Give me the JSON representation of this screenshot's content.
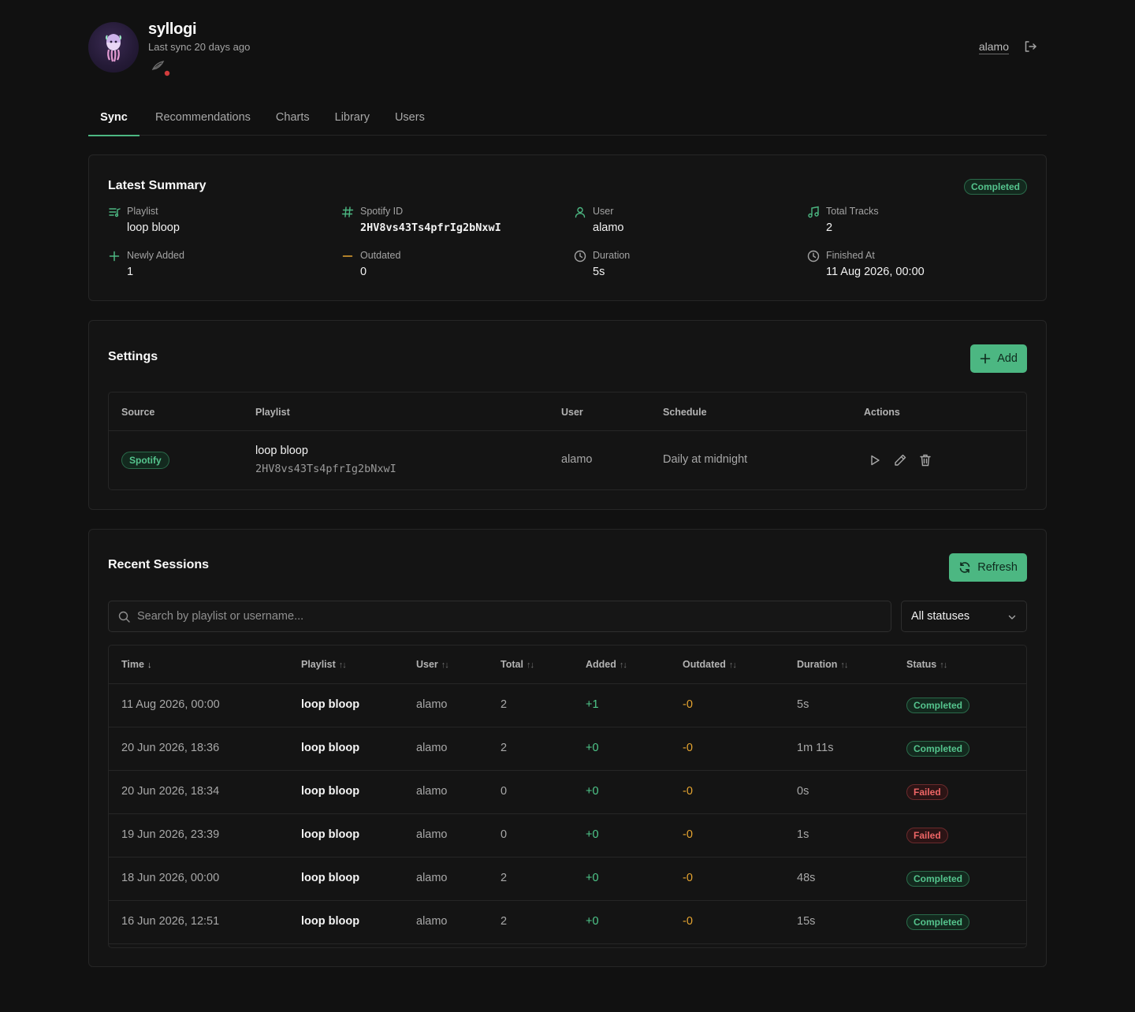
{
  "app": {
    "title": "syllogi",
    "last_sync": "Last sync 20 days ago",
    "user": "alamo"
  },
  "tabs": [
    {
      "label": "Sync",
      "active": true
    },
    {
      "label": "Recommendations",
      "active": false
    },
    {
      "label": "Charts",
      "active": false
    },
    {
      "label": "Library",
      "active": false
    },
    {
      "label": "Users",
      "active": false
    }
  ],
  "summary": {
    "title": "Latest Summary",
    "status": "Completed",
    "fields": {
      "playlist": {
        "label": "Playlist",
        "value": "loop bloop",
        "icon": "playlist-icon"
      },
      "spotify_id": {
        "label": "Spotify ID",
        "value": "2HV8vs43Ts4pfrIg2bNxwI",
        "icon": "hash-icon"
      },
      "user": {
        "label": "User",
        "value": "alamo",
        "icon": "user-icon"
      },
      "total_tracks": {
        "label": "Total Tracks",
        "value": "2",
        "icon": "music-note-icon"
      },
      "newly_added": {
        "label": "Newly Added",
        "value": "1",
        "icon": "plus-icon"
      },
      "outdated": {
        "label": "Outdated",
        "value": "0",
        "icon": "minus-icon"
      },
      "duration": {
        "label": "Duration",
        "value": "5s",
        "icon": "clock-icon"
      },
      "finished_at": {
        "label": "Finished At",
        "value": "11 Aug 2026, 00:00",
        "icon": "clock-icon"
      }
    }
  },
  "settings": {
    "title": "Settings",
    "add_label": "Add",
    "columns": [
      "Source",
      "Playlist",
      "User",
      "Schedule",
      "Actions"
    ],
    "rows": [
      {
        "source": "Spotify",
        "playlist": "loop bloop",
        "playlist_id": "2HV8vs43Ts4pfrIg2bNxwI",
        "user": "alamo",
        "schedule": "Daily at midnight"
      }
    ]
  },
  "sessions": {
    "title": "Recent Sessions",
    "refresh_label": "Refresh",
    "search_placeholder": "Search by playlist or username...",
    "status_filter": "All statuses",
    "columns": [
      {
        "label": "Time",
        "sort": "↓"
      },
      {
        "label": "Playlist",
        "sort": "↑↓"
      },
      {
        "label": "User",
        "sort": "↑↓"
      },
      {
        "label": "Total",
        "sort": "↑↓"
      },
      {
        "label": "Added",
        "sort": "↑↓"
      },
      {
        "label": "Outdated",
        "sort": "↑↓"
      },
      {
        "label": "Duration",
        "sort": "↑↓"
      },
      {
        "label": "Status",
        "sort": "↑↓"
      }
    ],
    "rows": [
      {
        "time": "11 Aug 2026, 00:00",
        "playlist": "loop bloop",
        "user": "alamo",
        "total": "2",
        "added": "+1",
        "outdated": "-0",
        "duration": "5s",
        "status": "Completed"
      },
      {
        "time": "20 Jun 2026, 18:36",
        "playlist": "loop bloop",
        "user": "alamo",
        "total": "2",
        "added": "+0",
        "outdated": "-0",
        "duration": "1m 11s",
        "status": "Completed"
      },
      {
        "time": "20 Jun 2026, 18:34",
        "playlist": "loop bloop",
        "user": "alamo",
        "total": "0",
        "added": "+0",
        "outdated": "-0",
        "duration": "0s",
        "status": "Failed"
      },
      {
        "time": "19 Jun 2026, 23:39",
        "playlist": "loop bloop",
        "user": "alamo",
        "total": "0",
        "added": "+0",
        "outdated": "-0",
        "duration": "1s",
        "status": "Failed"
      },
      {
        "time": "18 Jun 2026, 00:00",
        "playlist": "loop bloop",
        "user": "alamo",
        "total": "2",
        "added": "+0",
        "outdated": "-0",
        "duration": "48s",
        "status": "Completed"
      },
      {
        "time": "16 Jun 2026, 12:51",
        "playlist": "loop bloop",
        "user": "alamo",
        "total": "2",
        "added": "+0",
        "outdated": "-0",
        "duration": "15s",
        "status": "Completed"
      }
    ]
  },
  "colors": {
    "accent": "#4cb782",
    "background": "#111111",
    "card": "#141414",
    "border": "#262626",
    "added": "#4fc98b",
    "outdated": "#e5a430",
    "failed": "#ef6666"
  }
}
